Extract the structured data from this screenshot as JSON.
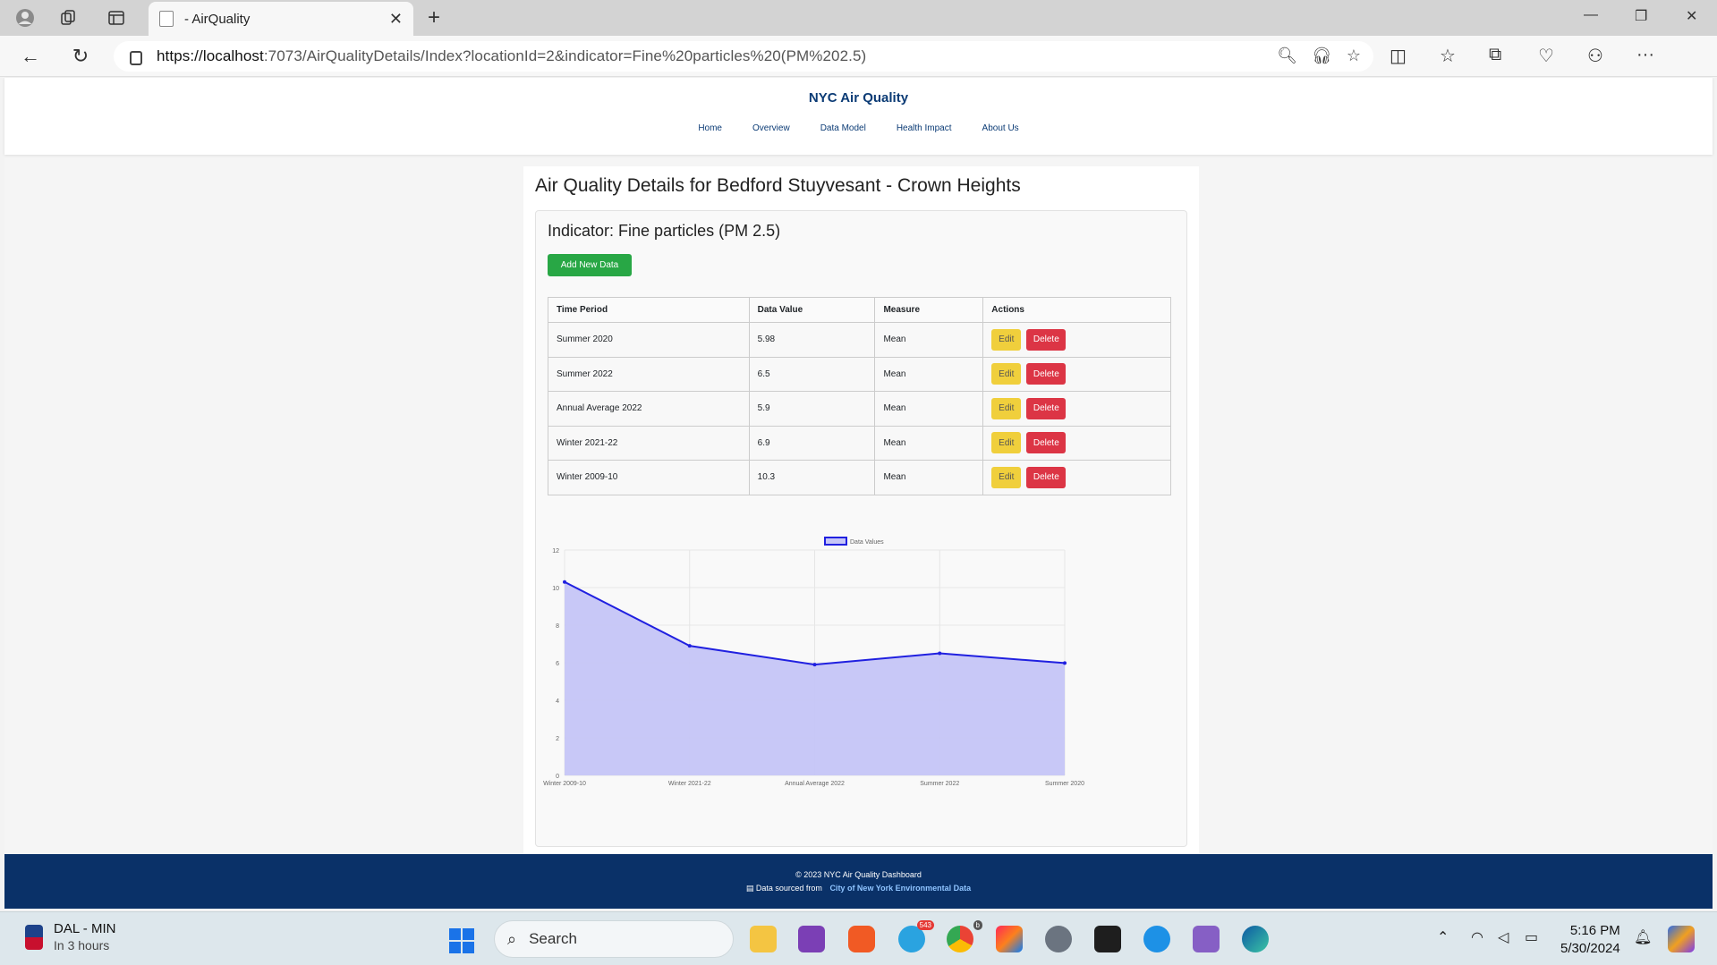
{
  "browser": {
    "tab_title": "- AirQuality",
    "url_host": "https://localhost",
    "url_rest": ":7073/AirQualityDetails/Index?locationId=2&indicator=Fine%20particles%20(PM%202.5)"
  },
  "site": {
    "brand": "NYC Air Quality",
    "nav": [
      "Home",
      "Overview",
      "Data Model",
      "Health Impact",
      "About Us"
    ]
  },
  "details": {
    "page_title": "Air Quality Details for Bedford Stuyvesant - Crown Heights",
    "indicator": "Indicator: Fine particles (PM 2.5)",
    "add_button": "Add New Data",
    "columns": [
      "Time Period",
      "Data Value",
      "Measure",
      "Actions"
    ],
    "rows": [
      {
        "period": "Summer 2020",
        "value": "5.98",
        "measure": "Mean"
      },
      {
        "period": "Summer 2022",
        "value": "6.5",
        "measure": "Mean"
      },
      {
        "period": "Annual Average 2022",
        "value": "5.9",
        "measure": "Mean"
      },
      {
        "period": "Winter 2021-22",
        "value": "6.9",
        "measure": "Mean"
      },
      {
        "period": "Winter 2009-10",
        "value": "10.3",
        "measure": "Mean"
      }
    ],
    "edit_label": "Edit",
    "delete_label": "Delete"
  },
  "chart_data": {
    "type": "area",
    "categories": [
      "Winter 2009-10",
      "Winter 2021-22",
      "Annual Average 2022",
      "Summer 2022",
      "Summer 2020"
    ],
    "series": [
      {
        "name": "Data Values",
        "values": [
          10.3,
          6.9,
          5.9,
          6.5,
          5.98
        ]
      }
    ],
    "ylim": [
      0,
      12
    ],
    "yticks": [
      0,
      2,
      4,
      6,
      8,
      10,
      12
    ],
    "grid": true,
    "legend": "top-center",
    "line_color": "#2020e0",
    "fill_color": "#c5c5f7"
  },
  "footer": {
    "copyright": "© 2023 NYC Air Quality Dashboard",
    "source_prefix": "Data sourced from",
    "source_link": "City of New York Environmental Data"
  },
  "taskbar": {
    "weather_title": "DAL - MIN",
    "weather_sub": "In 3 hours",
    "search": "Search",
    "telegram_badge": "543",
    "chrome_badge": "b",
    "time": "5:16 PM",
    "date": "5/30/2024"
  }
}
